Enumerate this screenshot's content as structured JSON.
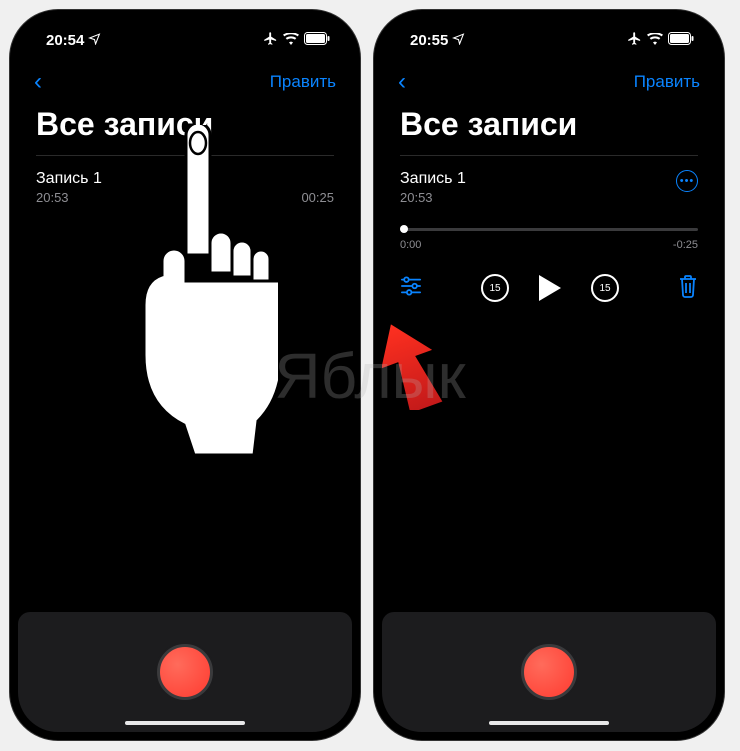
{
  "phone1": {
    "status": {
      "time": "20:54",
      "location_icon": "location-icon",
      "airplane_icon": "airplane-icon",
      "wifi_icon": "wifi-icon",
      "battery_icon": "battery-icon"
    },
    "nav": {
      "back": "‹",
      "edit": "Править"
    },
    "title": "Все записи",
    "recording": {
      "title": "Запись 1",
      "time": "20:53",
      "duration": "00:25"
    }
  },
  "phone2": {
    "status": {
      "time": "20:55"
    },
    "nav": {
      "back": "‹",
      "edit": "Править"
    },
    "title": "Все записи",
    "recording": {
      "title": "Запись 1",
      "time": "20:53",
      "pos": "0:00",
      "remaining": "-0:25",
      "skip_back": "15",
      "skip_fwd": "15"
    }
  },
  "watermark": "Яблык",
  "colors": {
    "accent": "#0a84ff",
    "record": "#ff3b30"
  }
}
